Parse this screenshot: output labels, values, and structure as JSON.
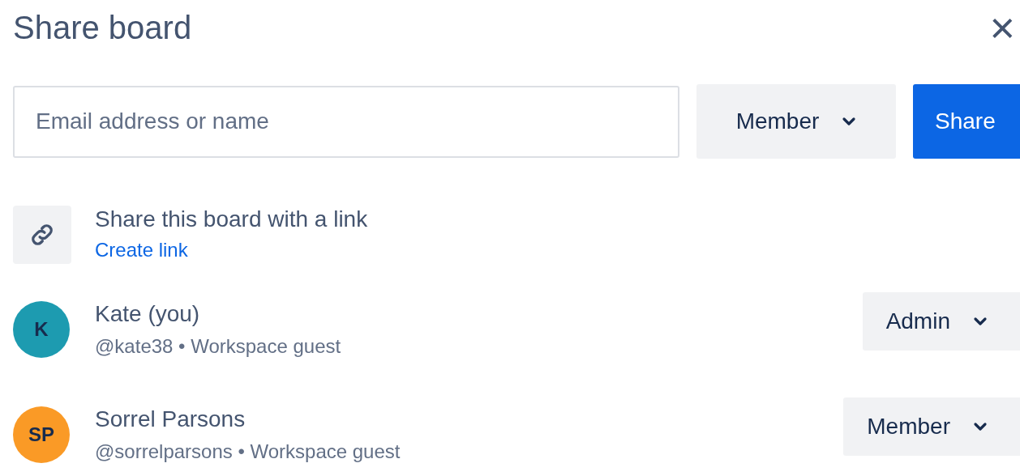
{
  "dialog": {
    "title": "Share board",
    "close": "×"
  },
  "invite": {
    "placeholder": "Email address or name",
    "role": "Member",
    "button": "Share"
  },
  "link_share": {
    "text": "Share this board with a link",
    "link": "Create link"
  },
  "members": [
    {
      "initials": "K",
      "name": "Kate (you)",
      "handle": "@kate38 • Workspace guest",
      "role": "Admin",
      "color": "#1d9bb0"
    },
    {
      "initials": "SP",
      "name": "Sorrel Parsons",
      "handle": "@sorrelparsons • Workspace guest",
      "role": "Member",
      "color": "#fa9a26"
    }
  ]
}
